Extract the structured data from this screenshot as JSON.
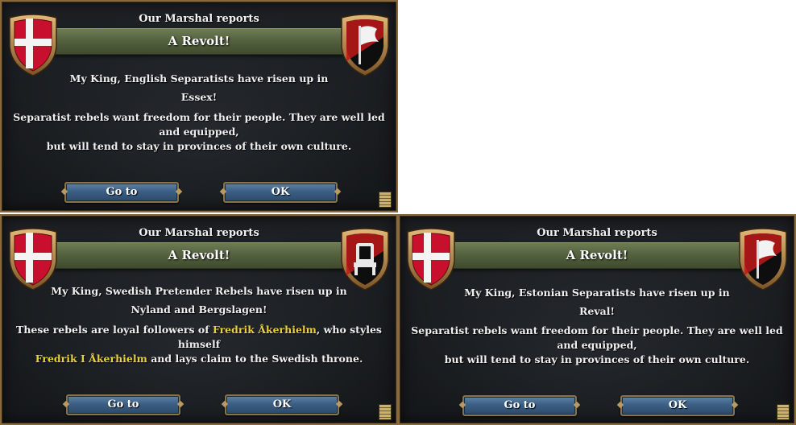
{
  "panels": [
    {
      "header": "Our Marshal reports",
      "title": "A Revolt!",
      "message_line1": "My King, English Separatists have risen up in",
      "message_line2": "Essex!",
      "description_line1": "Separatist rebels want freedom for their people. They are well led and equipped,",
      "description_line2": "but will tend to stay in provinces of their own culture.",
      "goto_label": "Go to",
      "ok_label": "OK",
      "rebel_flag_icon": "white-flag-icon"
    },
    {
      "header": "Our Marshal reports",
      "title": "A Revolt!",
      "message_line1": "My King, Swedish Pretender Rebels have risen up in",
      "message_line2": "Nyland and Bergslagen!",
      "description_pre": "These rebels are loyal followers of ",
      "pretender_name": "Fredrik Åkerhielm",
      "description_mid": ", who styles himself",
      "pretender_title": "Fredrik I Åkerhielm",
      "description_post": " and lays claim to the Swedish throne.",
      "goto_label": "Go to",
      "ok_label": "OK",
      "rebel_flag_icon": "throne-icon"
    },
    {
      "header": "Our Marshal reports",
      "title": "A Revolt!",
      "message_line1": "My King, Estonian Separatists have risen up in",
      "message_line2": "Reval!",
      "description_line1": "Separatist rebels want freedom for their people. They are well led and equipped,",
      "description_line2": "but will tend to stay in provinces of their own culture.",
      "goto_label": "Go to",
      "ok_label": "OK",
      "rebel_flag_icon": "white-flag-icon"
    }
  ],
  "colors": {
    "ribbon": "#55623f",
    "button": "#3b5f84",
    "highlight": "#e8d23c",
    "danish_red": "#c8102e"
  }
}
